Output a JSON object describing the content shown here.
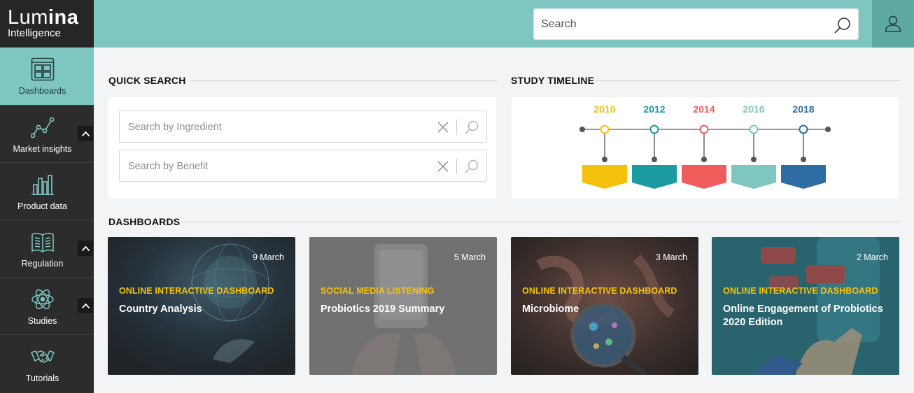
{
  "brand": {
    "name_light": "Lum",
    "name_bold": "ina",
    "subtitle": "Intelligence"
  },
  "header": {
    "search_placeholder": "Search"
  },
  "sidebar": {
    "items": [
      {
        "label": "Dashboards",
        "icon": "dashboard-icon",
        "active": true
      },
      {
        "label": "Market insights",
        "icon": "line-chart-icon",
        "expandable": true
      },
      {
        "label": "Product data",
        "icon": "bar-chart-icon"
      },
      {
        "label": "Regulation",
        "icon": "book-icon",
        "expandable": true
      },
      {
        "label": "Studies",
        "icon": "atom-icon",
        "expandable": true
      },
      {
        "label": "Tutorials",
        "icon": "handshake-icon"
      }
    ]
  },
  "quick_search": {
    "title": "QUICK SEARCH",
    "fields": [
      {
        "placeholder": "Search by Ingredient"
      },
      {
        "placeholder": "Search by Benefit"
      }
    ]
  },
  "timeline": {
    "title": "STUDY TIMELINE",
    "years": [
      {
        "label": "2010",
        "color": "#f4c20d"
      },
      {
        "label": "2012",
        "color": "#1b9aa0"
      },
      {
        "label": "2014",
        "color": "#f05c5c"
      },
      {
        "label": "2016",
        "color": "#7fc6c1"
      },
      {
        "label": "2018",
        "color": "#2e6ca4"
      }
    ]
  },
  "dashboards": {
    "title": "DASHBOARDS",
    "cards": [
      {
        "date": "9 March",
        "kind": "ONLINE INTERACTIVE DASHBOARD",
        "title": "Country Analysis"
      },
      {
        "date": "5 March",
        "kind": "SOCIAL MEDIA LISTENING",
        "title": "Probiotics 2019 Summary"
      },
      {
        "date": "3 March",
        "kind": "ONLINE INTERACTIVE DASHBOARD",
        "title": "Microbiome"
      },
      {
        "date": "2 March",
        "kind": "ONLINE INTERACTIVE DASHBOARD",
        "title": "Online Engagement of Probiotics 2020 Edition"
      }
    ]
  },
  "colors": {
    "accent": "#7fc6c1",
    "sidebar_bg": "#2c2c2c",
    "highlight_yellow": "#f4c20d"
  }
}
